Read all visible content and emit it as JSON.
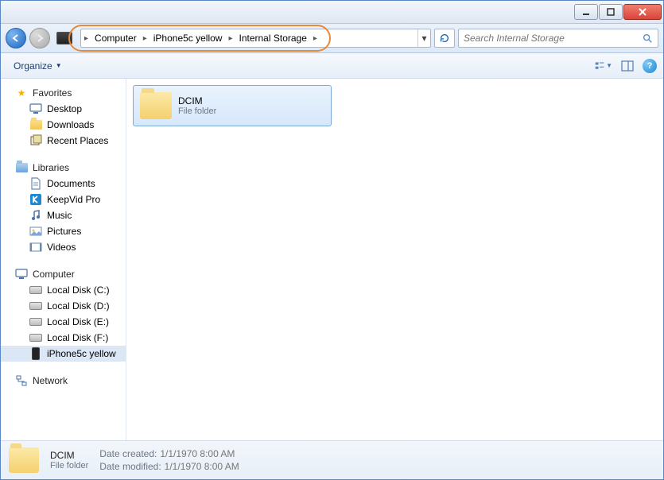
{
  "breadcrumb": [
    "Computer",
    "iPhone5c yellow",
    "Internal Storage"
  ],
  "search_placeholder": "Search Internal Storage",
  "toolbar": {
    "organize": "Organize"
  },
  "sidebar": {
    "favorites": {
      "label": "Favorites",
      "items": [
        "Desktop",
        "Downloads",
        "Recent Places"
      ]
    },
    "libraries": {
      "label": "Libraries",
      "items": [
        "Documents",
        "KeepVid Pro",
        "Music",
        "Pictures",
        "Videos"
      ]
    },
    "computer": {
      "label": "Computer",
      "items": [
        "Local Disk (C:)",
        "Local Disk (D:)",
        "Local Disk (E:)",
        "Local Disk (F:)",
        "iPhone5c yellow"
      ]
    },
    "network": {
      "label": "Network"
    }
  },
  "content": {
    "folder": {
      "name": "DCIM",
      "type": "File folder"
    }
  },
  "status": {
    "name": "DCIM",
    "type": "File folder",
    "date_created_label": "Date created:",
    "date_created": "1/1/1970 8:00 AM",
    "date_modified_label": "Date modified:",
    "date_modified": "1/1/1970 8:00 AM"
  }
}
